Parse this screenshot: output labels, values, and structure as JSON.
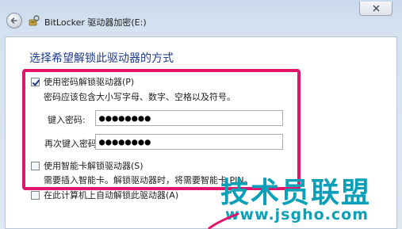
{
  "window": {
    "title": "BitLocker 驱动器加密(E:)"
  },
  "heading": "选择希望解锁此驱动器的方式",
  "options": {
    "password": {
      "label": "使用密码解锁驱动器(P)",
      "checked": true,
      "hint": "密码应该包含大小写字母、数字、空格以及符号。",
      "enter_label": "键入密码:",
      "enter_value": "●●●●●●●●",
      "reenter_label": "再次键入密码:",
      "reenter_value": "●●●●●●●●"
    },
    "smartcard": {
      "label": "使用智能卡解锁驱动器(S)",
      "checked": false,
      "hint": "需要插入智能卡。解锁驱动器时，将需要智能卡 PIN。"
    },
    "auto": {
      "label": "在此计算机上自动解锁此驱动器(A)",
      "checked": false
    }
  },
  "watermark": {
    "brand": "技术员联盟",
    "url": "www.jsgho.com"
  },
  "colors": {
    "highlight": "#e3146c",
    "heading": "#1e3b8c",
    "watermark": "#0aa0b8"
  },
  "icons": {
    "back": "back-arrow-icon",
    "app": "bitlocker-key-icon",
    "close": "close-icon"
  }
}
